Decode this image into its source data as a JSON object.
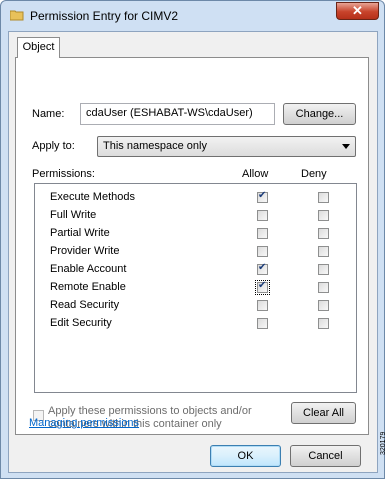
{
  "window": {
    "title": "Permission Entry for CIMV2",
    "close_glyph": "✕"
  },
  "tabs": [
    {
      "label": "Object"
    }
  ],
  "name_field": {
    "label": "Name:",
    "value": "cdaUser (ESHABAT-WS\\cdaUser)",
    "change_label": "Change..."
  },
  "apply_to": {
    "label": "Apply to:",
    "selected": "This namespace only"
  },
  "permissions": {
    "label": "Permissions:",
    "allow_header": "Allow",
    "deny_header": "Deny",
    "items": [
      {
        "name": "Execute Methods",
        "allow": true,
        "deny": false
      },
      {
        "name": "Full Write",
        "allow": false,
        "deny": false
      },
      {
        "name": "Partial Write",
        "allow": false,
        "deny": false
      },
      {
        "name": "Provider Write",
        "allow": false,
        "deny": false
      },
      {
        "name": "Enable Account",
        "allow": true,
        "deny": false
      },
      {
        "name": "Remote Enable",
        "allow": true,
        "deny": false
      },
      {
        "name": "Read Security",
        "allow": false,
        "deny": false
      },
      {
        "name": "Edit Security",
        "allow": false,
        "deny": false
      }
    ]
  },
  "apply_children": {
    "line1": "Apply these permissions to objects and/or",
    "line2": "containers within this container only",
    "checked": false
  },
  "clear_all_label": "Clear All",
  "managing_link": "Managing permissions",
  "ok_label": "OK",
  "cancel_label": "Cancel",
  "side_code": "320179"
}
